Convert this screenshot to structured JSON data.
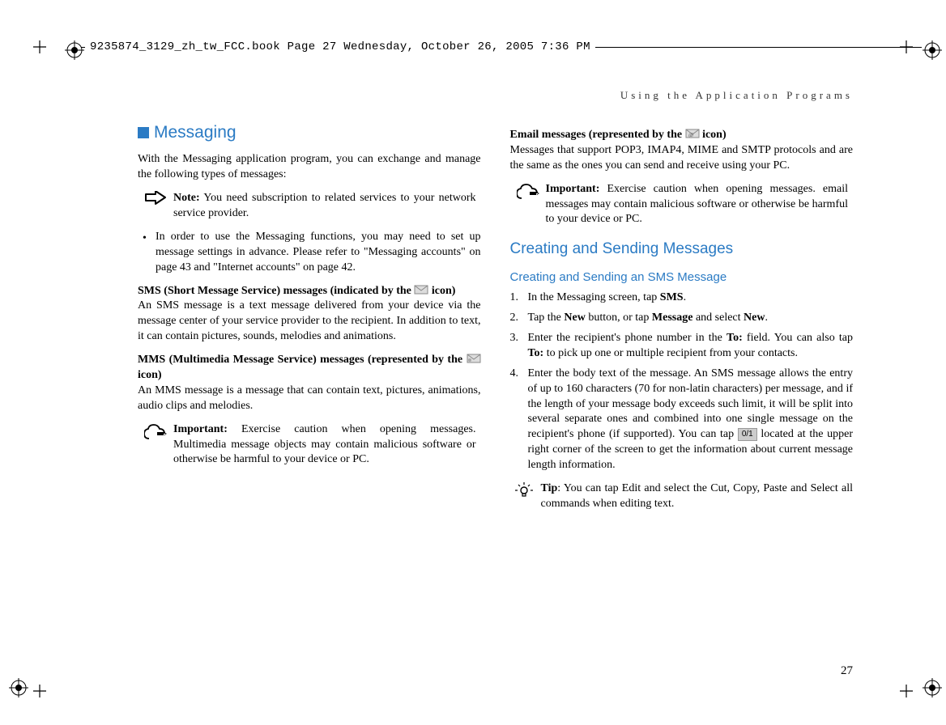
{
  "header": {
    "text": "9235874_3129_zh_tw_FCC.book  Page 27  Wednesday, October 26, 2005  7:36 PM"
  },
  "running_head": "Using the Application Programs",
  "left": {
    "section_title": "Messaging",
    "intro": "With the Messaging application program, you can exchange and manage the following types of messages:",
    "note_label": "Note:",
    "note_text": " You need subscription to related services to your network service provider.",
    "bullet_text": "In order to use the Messaging functions, you may need to set up message settings in advance. Please refer to \"Messaging accounts\" on page 43 and \"Internet accounts\" on page 42.",
    "sms_head_a": "SMS (Short Message Service) messages (indicated by the ",
    "sms_head_b": " icon)",
    "sms_body": "An SMS message is a text message delivered from your device via the message center of your service provider to the recipient. In addition to text, it can contain pictures, sounds, melodies and animations.",
    "mms_head_a": "MMS (Multimedia Message Service) messages (represented by the ",
    "mms_head_b": " icon)",
    "mms_body": "An MMS message is a message that can contain text, pictures, animations, audio clips and melodies.",
    "imp_label": "Important:",
    "imp_text": " Exercise caution when opening messages. Multimedia message objects may contain malicious software or otherwise be harmful to your device or PC."
  },
  "right": {
    "email_head_a": "Email messages (represented by the ",
    "email_head_b": " icon)",
    "email_body": "Messages that support POP3, IMAP4, MIME and SMTP protocols and are the same as the ones you can send and receive using your PC.",
    "imp_label": "Important:",
    "imp_text": " Exercise caution when opening messages. email messages may contain malicious software or otherwise be harmful to your device or PC.",
    "h2": "Creating and Sending Messages",
    "h3": "Creating and Sending an SMS Message",
    "step1_a": "In the Messaging screen, tap ",
    "step1_b": "SMS",
    "step1_c": ".",
    "step2_a": "Tap the ",
    "step2_b": "New",
    "step2_c": " button, or tap ",
    "step2_d": "Message",
    "step2_e": " and select ",
    "step2_f": "New",
    "step2_g": ".",
    "step3_a": "Enter the recipient's phone number in the ",
    "step3_b": "To:",
    "step3_c": " field. You can also tap ",
    "step3_d": "To:",
    "step3_e": " to pick up one or multiple recipient from your contacts.",
    "step4_a": "Enter the body text of the message. An SMS message allows the entry of up to 160 characters (70 for non-latin characters) per message, and if the length of your message body exceeds such limit, it will be split into several separate ones and combined into one single message on the recipient's phone (if supported). You can tap ",
    "step4_badge": "0/1",
    "step4_b": " located at the upper right corner of the screen to get the information about current message length information.",
    "tip_label": "Tip",
    "tip_text": ": You can tap Edit and select the Cut, Copy, Paste and Select all commands when editing text."
  },
  "page_num": "27"
}
